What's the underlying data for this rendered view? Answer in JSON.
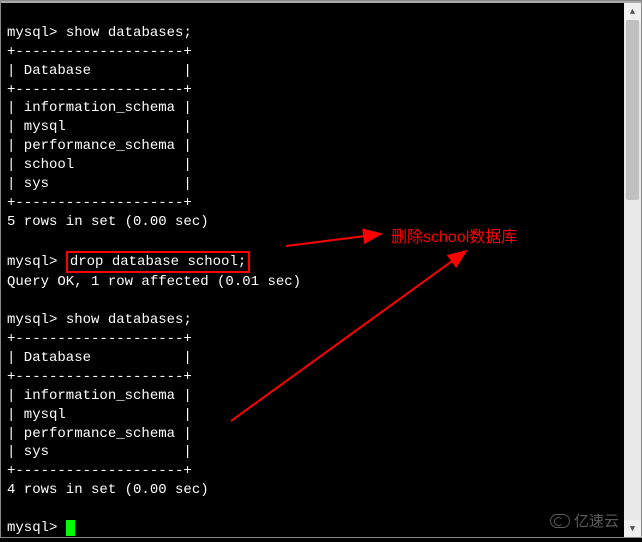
{
  "session": {
    "prompt": "mysql>",
    "commands": {
      "show1": "show databases;",
      "drop": "drop database school;",
      "show2": "show databases;"
    },
    "result1": {
      "border_top": "+--------------------+",
      "header": "| Database           |",
      "rows": [
        "| information_schema |",
        "| mysql              |",
        "| performance_schema |",
        "| school             |",
        "| sys                |"
      ],
      "footer": "5 rows in set (0.00 sec)"
    },
    "drop_result": "Query OK, 1 row affected (0.01 sec)",
    "result2": {
      "border_top": "+--------------------+",
      "header": "| Database           |",
      "rows": [
        "| information_schema |",
        "| mysql              |",
        "| performance_schema |",
        "| sys                |"
      ],
      "footer": "4 rows in set (0.00 sec)"
    },
    "blank": ""
  },
  "annotation": {
    "text": "删除school数据库",
    "color": "#ff0000"
  },
  "watermark": {
    "text": "亿速云"
  }
}
